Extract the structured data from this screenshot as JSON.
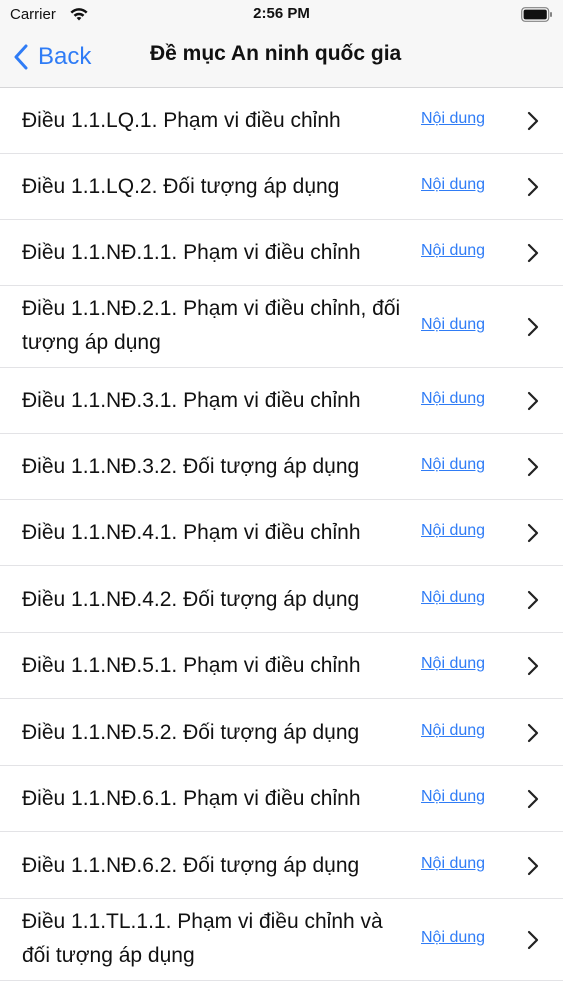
{
  "status_bar": {
    "carrier": "Carrier",
    "time": "2:56 PM"
  },
  "nav": {
    "back_label": "Back",
    "title": "Đề mục An ninh quốc gia"
  },
  "rows": [
    {
      "title": "Điều 1.1.LQ.1. Phạm vi điều chỉnh",
      "link": "Nội dung"
    },
    {
      "title": "Điều 1.1.LQ.2. Đối tượng áp dụng",
      "link": "Nội dung"
    },
    {
      "title": "Điều 1.1.NĐ.1.1. Phạm vi điều chỉnh",
      "link": "Nội dung"
    },
    {
      "title": "Điều 1.1.NĐ.2.1. Phạm vi điều chỉnh, đối tượng áp dụng",
      "link": "Nội dung"
    },
    {
      "title": "Điều 1.1.NĐ.3.1. Phạm vi điều chỉnh",
      "link": "Nội dung"
    },
    {
      "title": "Điều 1.1.NĐ.3.2. Đối tượng áp dụng",
      "link": "Nội dung"
    },
    {
      "title": "Điều 1.1.NĐ.4.1. Phạm vi điều chỉnh",
      "link": "Nội dung"
    },
    {
      "title": "Điều 1.1.NĐ.4.2. Đối tượng áp dụng",
      "link": "Nội dung"
    },
    {
      "title": "Điều 1.1.NĐ.5.1. Phạm vi điều chỉnh",
      "link": "Nội dung"
    },
    {
      "title": "Điều 1.1.NĐ.5.2. Đối tượng áp dụng",
      "link": "Nội dung"
    },
    {
      "title": "Điều 1.1.NĐ.6.1. Phạm vi điều chỉnh",
      "link": "Nội dung"
    },
    {
      "title": "Điều 1.1.NĐ.6.2. Đối tượng áp dụng",
      "link": "Nội dung"
    },
    {
      "title": "Điều 1.1.TL.1.1. Phạm vi điều chỉnh và đối tượng áp dụng",
      "link": "Nội dung"
    }
  ],
  "colors": {
    "accent": "#2f7cf6",
    "bar_background": "#f7f7f7",
    "separator": "#e3e3e6"
  },
  "icons": {
    "wifi": "wifi-icon",
    "battery": "battery-icon",
    "back": "chevron-left-icon",
    "row_disclosure": "chevron-right-icon"
  }
}
